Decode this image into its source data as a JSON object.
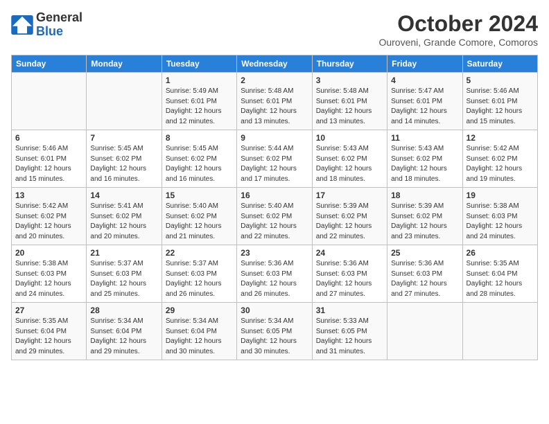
{
  "header": {
    "logo_line1": "General",
    "logo_line2": "Blue",
    "month": "October 2024",
    "location": "Ouroveni, Grande Comore, Comoros"
  },
  "days_of_week": [
    "Sunday",
    "Monday",
    "Tuesday",
    "Wednesday",
    "Thursday",
    "Friday",
    "Saturday"
  ],
  "weeks": [
    [
      {
        "day": "",
        "info": ""
      },
      {
        "day": "",
        "info": ""
      },
      {
        "day": "1",
        "info": "Sunrise: 5:49 AM\nSunset: 6:01 PM\nDaylight: 12 hours and 12 minutes."
      },
      {
        "day": "2",
        "info": "Sunrise: 5:48 AM\nSunset: 6:01 PM\nDaylight: 12 hours and 13 minutes."
      },
      {
        "day": "3",
        "info": "Sunrise: 5:48 AM\nSunset: 6:01 PM\nDaylight: 12 hours and 13 minutes."
      },
      {
        "day": "4",
        "info": "Sunrise: 5:47 AM\nSunset: 6:01 PM\nDaylight: 12 hours and 14 minutes."
      },
      {
        "day": "5",
        "info": "Sunrise: 5:46 AM\nSunset: 6:01 PM\nDaylight: 12 hours and 15 minutes."
      }
    ],
    [
      {
        "day": "6",
        "info": "Sunrise: 5:46 AM\nSunset: 6:01 PM\nDaylight: 12 hours and 15 minutes."
      },
      {
        "day": "7",
        "info": "Sunrise: 5:45 AM\nSunset: 6:02 PM\nDaylight: 12 hours and 16 minutes."
      },
      {
        "day": "8",
        "info": "Sunrise: 5:45 AM\nSunset: 6:02 PM\nDaylight: 12 hours and 16 minutes."
      },
      {
        "day": "9",
        "info": "Sunrise: 5:44 AM\nSunset: 6:02 PM\nDaylight: 12 hours and 17 minutes."
      },
      {
        "day": "10",
        "info": "Sunrise: 5:43 AM\nSunset: 6:02 PM\nDaylight: 12 hours and 18 minutes."
      },
      {
        "day": "11",
        "info": "Sunrise: 5:43 AM\nSunset: 6:02 PM\nDaylight: 12 hours and 18 minutes."
      },
      {
        "day": "12",
        "info": "Sunrise: 5:42 AM\nSunset: 6:02 PM\nDaylight: 12 hours and 19 minutes."
      }
    ],
    [
      {
        "day": "13",
        "info": "Sunrise: 5:42 AM\nSunset: 6:02 PM\nDaylight: 12 hours and 20 minutes."
      },
      {
        "day": "14",
        "info": "Sunrise: 5:41 AM\nSunset: 6:02 PM\nDaylight: 12 hours and 20 minutes."
      },
      {
        "day": "15",
        "info": "Sunrise: 5:40 AM\nSunset: 6:02 PM\nDaylight: 12 hours and 21 minutes."
      },
      {
        "day": "16",
        "info": "Sunrise: 5:40 AM\nSunset: 6:02 PM\nDaylight: 12 hours and 22 minutes."
      },
      {
        "day": "17",
        "info": "Sunrise: 5:39 AM\nSunset: 6:02 PM\nDaylight: 12 hours and 22 minutes."
      },
      {
        "day": "18",
        "info": "Sunrise: 5:39 AM\nSunset: 6:02 PM\nDaylight: 12 hours and 23 minutes."
      },
      {
        "day": "19",
        "info": "Sunrise: 5:38 AM\nSunset: 6:03 PM\nDaylight: 12 hours and 24 minutes."
      }
    ],
    [
      {
        "day": "20",
        "info": "Sunrise: 5:38 AM\nSunset: 6:03 PM\nDaylight: 12 hours and 24 minutes."
      },
      {
        "day": "21",
        "info": "Sunrise: 5:37 AM\nSunset: 6:03 PM\nDaylight: 12 hours and 25 minutes."
      },
      {
        "day": "22",
        "info": "Sunrise: 5:37 AM\nSunset: 6:03 PM\nDaylight: 12 hours and 26 minutes."
      },
      {
        "day": "23",
        "info": "Sunrise: 5:36 AM\nSunset: 6:03 PM\nDaylight: 12 hours and 26 minutes."
      },
      {
        "day": "24",
        "info": "Sunrise: 5:36 AM\nSunset: 6:03 PM\nDaylight: 12 hours and 27 minutes."
      },
      {
        "day": "25",
        "info": "Sunrise: 5:36 AM\nSunset: 6:03 PM\nDaylight: 12 hours and 27 minutes."
      },
      {
        "day": "26",
        "info": "Sunrise: 5:35 AM\nSunset: 6:04 PM\nDaylight: 12 hours and 28 minutes."
      }
    ],
    [
      {
        "day": "27",
        "info": "Sunrise: 5:35 AM\nSunset: 6:04 PM\nDaylight: 12 hours and 29 minutes."
      },
      {
        "day": "28",
        "info": "Sunrise: 5:34 AM\nSunset: 6:04 PM\nDaylight: 12 hours and 29 minutes."
      },
      {
        "day": "29",
        "info": "Sunrise: 5:34 AM\nSunset: 6:04 PM\nDaylight: 12 hours and 30 minutes."
      },
      {
        "day": "30",
        "info": "Sunrise: 5:34 AM\nSunset: 6:05 PM\nDaylight: 12 hours and 30 minutes."
      },
      {
        "day": "31",
        "info": "Sunrise: 5:33 AM\nSunset: 6:05 PM\nDaylight: 12 hours and 31 minutes."
      },
      {
        "day": "",
        "info": ""
      },
      {
        "day": "",
        "info": ""
      }
    ]
  ]
}
